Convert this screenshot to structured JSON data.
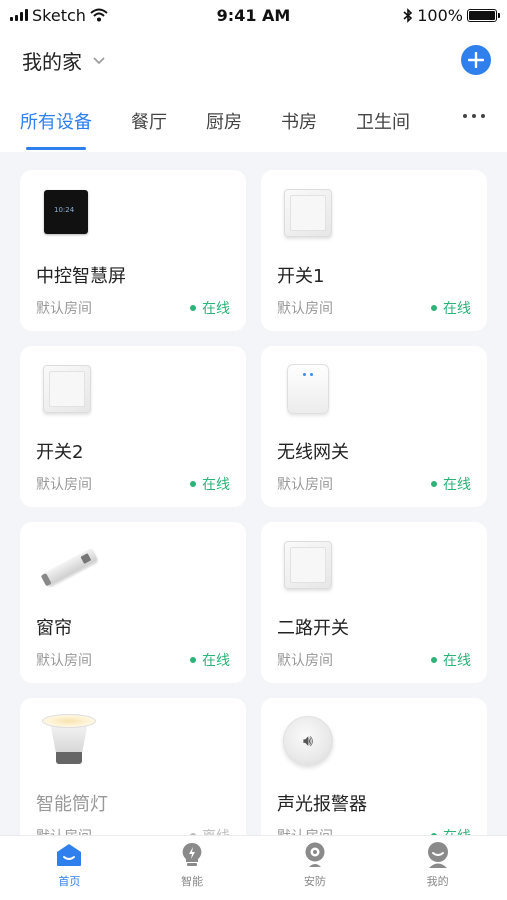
{
  "status_bar": {
    "carrier": "Sketch",
    "time": "9:41 AM",
    "battery_percent": "100%",
    "battery_level": 1.0
  },
  "header": {
    "title": "我的家",
    "dropdown_icon": "chevron-down-icon",
    "add_icon": "plus-icon"
  },
  "tabs": [
    {
      "label": "所有设备",
      "active": true
    },
    {
      "label": "餐厅",
      "active": false
    },
    {
      "label": "厨房",
      "active": false
    },
    {
      "label": "书房",
      "active": false
    },
    {
      "label": "卫生间",
      "active": false
    }
  ],
  "devices": [
    {
      "name": "中控智慧屏",
      "room": "默认房间",
      "status": "在线",
      "icon": "control-screen-icon"
    },
    {
      "name": "开关1",
      "room": "默认房间",
      "status": "在线",
      "icon": "wall-switch-icon"
    },
    {
      "name": "开关2",
      "room": "默认房间",
      "status": "在线",
      "icon": "wall-switch-icon"
    },
    {
      "name": "无线网关",
      "room": "默认房间",
      "status": "在线",
      "icon": "gateway-icon"
    },
    {
      "name": "窗帘",
      "room": "默认房间",
      "status": "在线",
      "icon": "curtain-motor-icon"
    },
    {
      "name": "二路开关",
      "room": "默认房间",
      "status": "在线",
      "icon": "wall-switch-icon"
    },
    {
      "name": "智能筒灯",
      "room": "默认房间",
      "status": "离线",
      "icon": "downlight-icon"
    },
    {
      "name": "声光报警器",
      "room": "默认房间",
      "status": "在线",
      "icon": "alarm-icon"
    }
  ],
  "bottom_nav": [
    {
      "label": "首页",
      "icon": "home-icon",
      "active": true
    },
    {
      "label": "智能",
      "icon": "lightning-bulb-icon",
      "active": false
    },
    {
      "label": "安防",
      "icon": "camera-icon",
      "active": false
    },
    {
      "label": "我的",
      "icon": "user-icon",
      "active": false
    }
  ],
  "colors": {
    "accent": "#2f80ed",
    "online": "#2db37a",
    "background": "#f4f5f8"
  }
}
